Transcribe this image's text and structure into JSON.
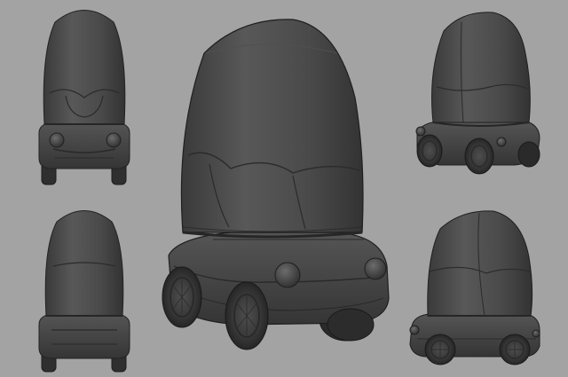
{
  "scene": {
    "background_color": "#a3a3a3",
    "model_color": "#4a4a4a",
    "model_shadow_color": "#2b2b2b",
    "model_highlight_color": "#6a6a6a",
    "wireframe_color": "#242424",
    "views": [
      {
        "name": "front-top-left"
      },
      {
        "name": "back-bottom-left"
      },
      {
        "name": "perspective-center"
      },
      {
        "name": "rear-three-quarter-top-right"
      },
      {
        "name": "side-bottom-right"
      }
    ]
  }
}
